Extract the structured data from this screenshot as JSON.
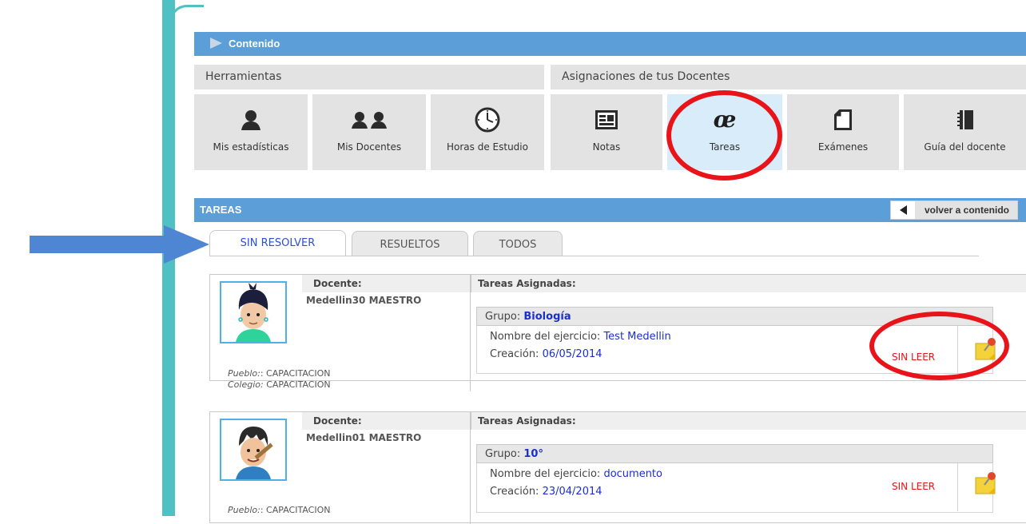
{
  "sections": {
    "contenido_label": "Contenido",
    "tareas_label": "TAREAS",
    "volver_label": "volver a contenido"
  },
  "subbars": {
    "herramientas": "Herramientas",
    "asignaciones": "Asignaciones de tus Docentes"
  },
  "tiles": [
    {
      "label": "Mis estadísticas",
      "icon": "person-icon"
    },
    {
      "label": "Mis Docentes",
      "icon": "people-icon"
    },
    {
      "label": "Horas de Estudio",
      "icon": "clock-icon"
    },
    {
      "label": "Notas",
      "icon": "id-card-icon"
    },
    {
      "label": "Tareas",
      "icon": "oe-logo-icon"
    },
    {
      "label": "Exámenes",
      "icon": "document-icon"
    },
    {
      "label": "Guía del docente",
      "icon": "notebook-icon"
    }
  ],
  "tabs": [
    {
      "label": "SIN RESOLVER"
    },
    {
      "label": "RESUELTOS"
    },
    {
      "label": "TODOS"
    }
  ],
  "cards": [
    {
      "docente_label": "Docente:",
      "docente_name": "Medellin30 MAESTRO",
      "pueblo_key": "Pueblo:",
      "pueblo_val": ": CAPACITACION",
      "colegio_key": "Colegio:",
      "colegio_val": " CAPACITACION",
      "tareas_label": "Tareas Asignadas:",
      "grupo_key": "Grupo:",
      "grupo_val": "Biología",
      "ejercicio_key": "Nombre del ejercicio:",
      "ejercicio_val": "Test Medellin",
      "creacion_key": "Creación:",
      "creacion_val": "06/05/2014",
      "status": "SIN LEER"
    },
    {
      "docente_label": "Docente:",
      "docente_name": "Medellin01 MAESTRO",
      "pueblo_key": "Pueblo:",
      "pueblo_val": ": CAPACITACION",
      "tareas_label": "Tareas Asignadas:",
      "grupo_key": "Grupo:",
      "grupo_val": "10°",
      "ejercicio_key": "Nombre del ejercicio:",
      "ejercicio_val": "documento",
      "creacion_key": "Creación:",
      "creacion_val": "23/04/2014",
      "status": "SIN LEER"
    }
  ],
  "colors": {
    "accent_blue": "#5b9ed8",
    "teal": "#4fc0c4",
    "highlight_red": "#e8141a",
    "link_blue": "#1a2fd0"
  }
}
